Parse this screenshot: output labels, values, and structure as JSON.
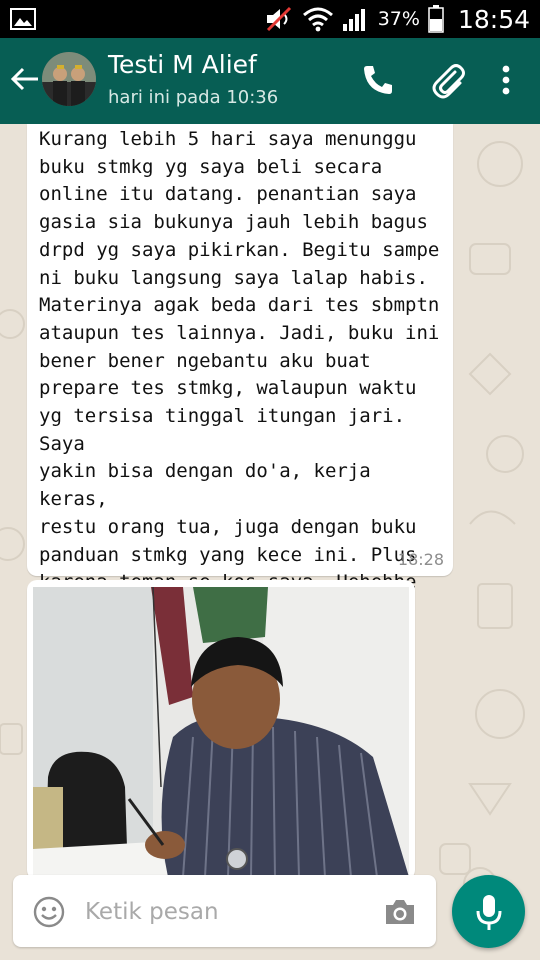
{
  "status_bar": {
    "battery_percent": "37%",
    "time": "18:54",
    "icons": [
      "image-icon",
      "mute-icon",
      "wifi-icon",
      "signal-icon",
      "battery-icon"
    ]
  },
  "header": {
    "contact_name": "Testi M Alief",
    "last_seen": "hari ini pada 10:36",
    "icons": [
      "back-arrow-icon",
      "avatar",
      "phone-icon",
      "attach-icon",
      "more-vert-icon"
    ],
    "color": "#075e54"
  },
  "messages": [
    {
      "type": "text",
      "text": "Kurang lebih 5 hari saya menunggu\nbuku stmkg yg saya beli secara\nonline itu datang. penantian saya\ngasia sia bukunya jauh lebih bagus\ndrpd yg saya pikirkan. Begitu sampe\nni buku langsung saya lalap habis.\nMaterinya agak beda dari tes sbmptn\nataupun tes lainnya. Jadi, buku ini\nbener bener ngebantu aku buat\nprepare tes stmkg, walaupun waktu\nyg tersisa tinggal itungan jari. Saya\nyakin bisa dengan do'a, kerja keras,\nrestu orang tua, juga dengan buku\npanduan stmkg yang kece ini. Plus\nkarena teman se kos saya. Hehehhe",
      "time": "18:28"
    },
    {
      "type": "image"
    }
  ],
  "composer": {
    "placeholder": "Ketik pesan",
    "value": "",
    "icons": [
      "emoji-icon",
      "camera-icon",
      "mic-icon"
    ],
    "mic_color": "#00897b"
  }
}
